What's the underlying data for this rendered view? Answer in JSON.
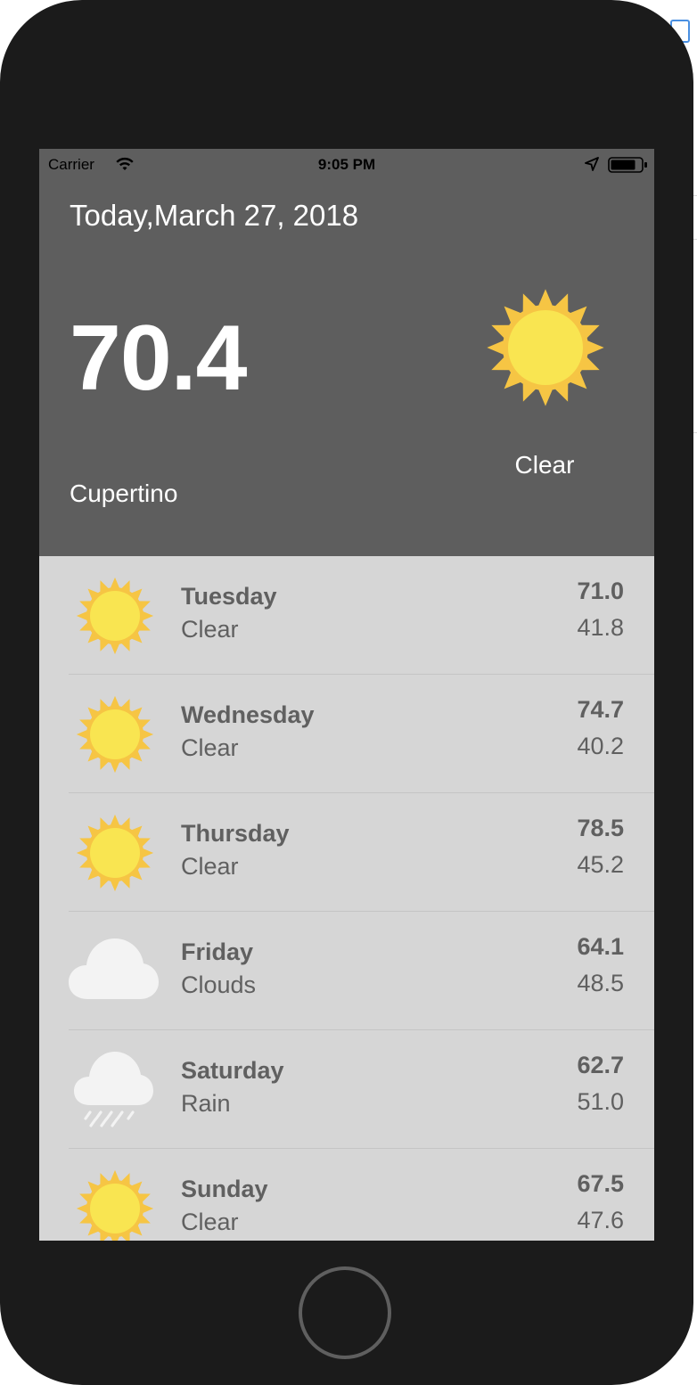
{
  "status_bar": {
    "carrier": "Carrier",
    "time": "9:05 PM"
  },
  "current": {
    "date": "Today,March 27, 2018",
    "temperature": "70.4",
    "condition": "Clear",
    "city": "Cupertino",
    "icon": "sun-icon"
  },
  "forecast": [
    {
      "day": "Tuesday",
      "condition": "Clear",
      "high": "71.0",
      "low": "41.8",
      "icon": "sun-icon"
    },
    {
      "day": "Wednesday",
      "condition": "Clear",
      "high": "74.7",
      "low": "40.2",
      "icon": "sun-icon"
    },
    {
      "day": "Thursday",
      "condition": "Clear",
      "high": "78.5",
      "low": "45.2",
      "icon": "sun-icon"
    },
    {
      "day": "Friday",
      "condition": "Clouds",
      "high": "64.1",
      "low": "48.5",
      "icon": "cloud-icon"
    },
    {
      "day": "Saturday",
      "condition": "Rain",
      "high": "62.7",
      "low": "51.0",
      "icon": "rain-cloud-icon"
    },
    {
      "day": "Sunday",
      "condition": "Clear",
      "high": "67.5",
      "low": "47.6",
      "icon": "sun-icon"
    }
  ],
  "colors": {
    "header_bg": "#5e5e5e",
    "list_bg": "#d6d6d6",
    "sun_outer": "#f6c544",
    "sun_inner": "#f9e551",
    "text": "#606060"
  }
}
